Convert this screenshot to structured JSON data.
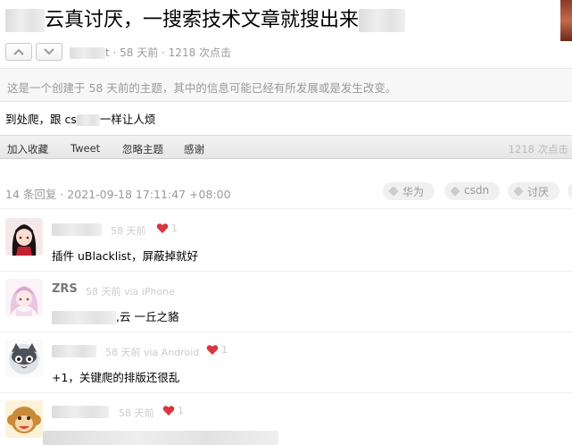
{
  "topic": {
    "title": "云真讨厌，一搜索技术文章就搜出来",
    "meta": "t · 58 天前 · 1218 次点击",
    "notice": "这是一个创建于 58 天前的主题，其中的信息可能已经有所发展或是发生改变。",
    "body_prefix": "到处爬，跟 cs",
    "body_suffix": "一样让人烦"
  },
  "actions": {
    "favorite": "加入收藏",
    "tweet": "Tweet",
    "ignore": "忽略主题",
    "thanks": "感谢",
    "clicks": "1218 次点击"
  },
  "replies_header": {
    "summary": "14 条回复  ·  2021-09-18 17:11:47 +08:00",
    "tags": [
      "华为",
      "csdn",
      "讨厌"
    ]
  },
  "replies": [
    {
      "time": "58 天前",
      "likes": "1",
      "content": "插件 uBlacklist，屏蔽掉就好"
    },
    {
      "username": "ZRS",
      "time": "58 天前 via iPhone",
      "content": ",云 一丘之貉"
    },
    {
      "time": "58 天前 via Android",
      "likes": "1",
      "content": "+1，关键爬的排版还很乱"
    },
    {
      "time": "58 天前",
      "likes": "1"
    }
  ],
  "colors": {
    "heart": "#d9363e",
    "muted": "#999999",
    "light": "#cccccc"
  }
}
